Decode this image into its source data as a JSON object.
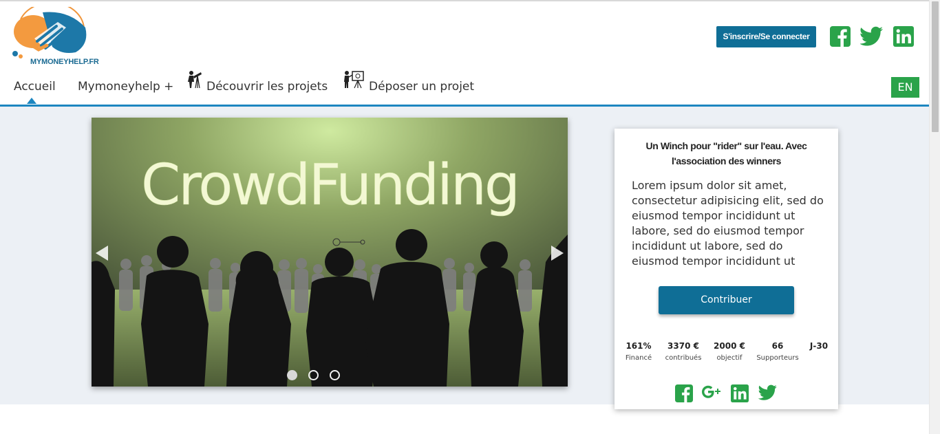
{
  "logo": {
    "text": "MYMONEYHELP.FR"
  },
  "header": {
    "signin_label": "S'inscrire/Se connecter",
    "social": [
      "facebook-icon",
      "twitter-icon",
      "linkedin-icon"
    ]
  },
  "nav": {
    "items": [
      {
        "label": "Accueil",
        "active": true
      },
      {
        "label": "Mymoneyhelp +"
      },
      {
        "label": "Découvrir les projets",
        "icon": "telescope-person-icon"
      },
      {
        "label": "Déposer un projet",
        "icon": "presenter-board-icon"
      }
    ],
    "lang": "EN"
  },
  "slider": {
    "headline": "CrowdFunding",
    "active_dot": 0,
    "dot_count": 3
  },
  "project": {
    "title": "Un Winch pour \"rider\" sur l'eau. Avec l'association des winners",
    "description": "Lorem ipsum dolor sit amet, consectetur adipisicing elit, sed do eiusmod tempor incididunt ut labore, sed do eiusmod tempor incididunt ut labore, sed do eiusmod tempor incididunt ut",
    "cta_label": "Contribuer",
    "stats": [
      {
        "value": "161%",
        "label": "Financé"
      },
      {
        "value": "3370 €",
        "label": "contribués"
      },
      {
        "value": "2000 €",
        "label": "objectif"
      },
      {
        "value": "66",
        "label": "Supporteurs"
      },
      {
        "value": "J-30",
        "label": ""
      }
    ],
    "share": [
      "facebook-icon",
      "google-plus-icon",
      "linkedin-icon",
      "twitter-icon"
    ]
  },
  "colors": {
    "brand_blue": "#0f6e96",
    "nav_accent": "#1c86c0",
    "green": "#2aa34a",
    "band_bg": "#ecf0f5"
  }
}
